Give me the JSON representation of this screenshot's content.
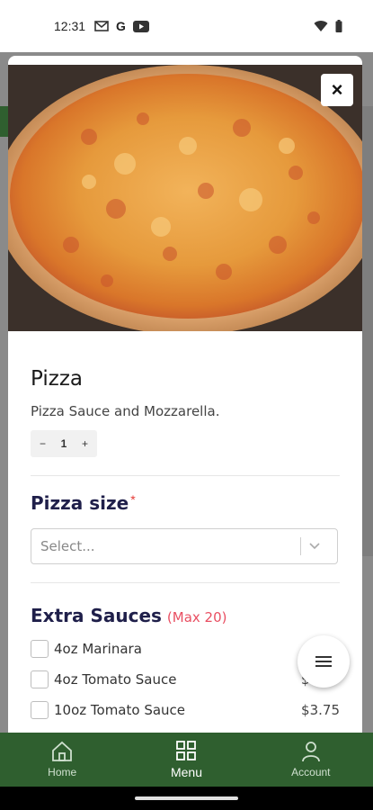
{
  "status_bar": {
    "time": "12:31",
    "g_label": "G"
  },
  "modal": {
    "title": "Pizza",
    "description": "Pizza Sauce and Mozzarella.",
    "quantity": {
      "minus": "−",
      "value": "1",
      "plus": "+"
    },
    "close_symbol": "×"
  },
  "pizza_size": {
    "title": "Pizza size",
    "required_mark": "*",
    "select_placeholder": "Select..."
  },
  "extra_sauces": {
    "title": "Extra Sauces",
    "max_note": "(Max 20)",
    "options": [
      {
        "label": "4oz Marinara",
        "price": ""
      },
      {
        "label": "4oz Tomato Sauce",
        "price": "$1.75"
      },
      {
        "label": "10oz Tomato Sauce",
        "price": "$3.75"
      }
    ]
  },
  "bottom_nav": {
    "items": [
      {
        "label": "Home",
        "icon": "home-icon"
      },
      {
        "label": "Menu",
        "icon": "grid-icon"
      },
      {
        "label": "Account",
        "icon": "person-icon"
      }
    ],
    "active": "Menu"
  },
  "colors": {
    "nav_green": "#2f5f2f",
    "heading_navy": "#1f1f4a",
    "accent_red": "#e94f62"
  }
}
